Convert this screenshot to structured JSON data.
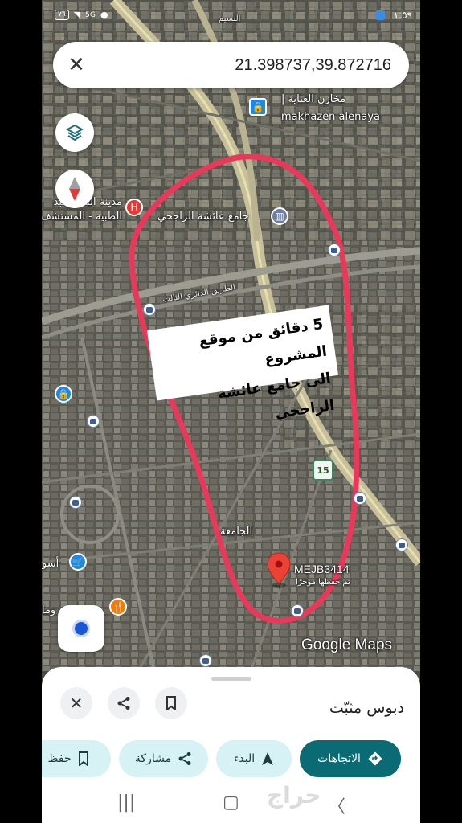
{
  "status_bar": {
    "time": "١:٥٩",
    "battery": "٧٦",
    "network": "5G"
  },
  "search": {
    "value": "21.398737,39.872716",
    "close_icon": "close-icon"
  },
  "map": {
    "labels": {
      "naseem": "النسيم",
      "store_ar": "مخازن العناية |",
      "store_en": "makhazen alenaya",
      "mosque": "جامع عائشة الراجحي",
      "hospital_line1": "مدينة الملك عبد",
      "hospital_line2": "الطبية - المستشف",
      "ring_road": "الطريق الدائري الثالث",
      "jamea": "الجامعة",
      "left_edge_1": "أسو",
      "left_edge_2": "وما",
      "route_num": "15"
    },
    "annotation": {
      "line1": "5 دقائق من موقع المشروع",
      "line2": "الى جامع عائشة الراجحي"
    },
    "dropped_pin": {
      "label": "MEJB3414",
      "sub": "تم حفظها مؤخرًا"
    },
    "attribution": "Google Maps",
    "highlight_color": "#e8395a"
  },
  "sheet": {
    "title": "دبوس مثبّت",
    "chips": {
      "directions": "الاتجاهات",
      "start": "البدء",
      "share": "مشاركة",
      "save": "حفظ"
    }
  },
  "watermark": "حراج"
}
